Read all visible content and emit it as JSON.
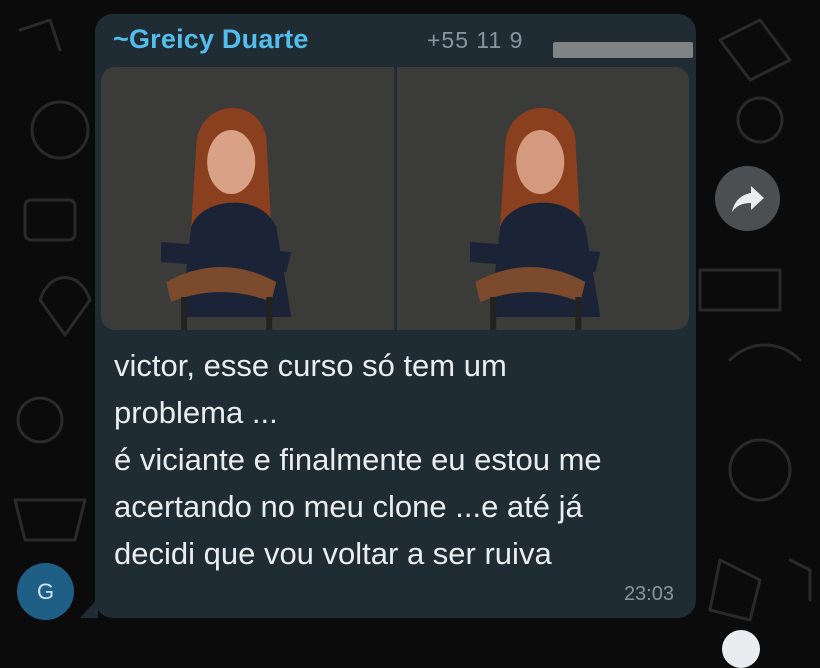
{
  "chat": {
    "sender_name": "~Greicy Duarte",
    "sender_phone": "+55 11 9",
    "avatar_initial": "G",
    "photos": [
      {
        "icon": "portrait-photo-icon"
      },
      {
        "icon": "portrait-photo-icon"
      }
    ],
    "message_lines": [
      "victor, esse curso só tem um",
      "problema ...",
      "é viciante e finalmente eu estou me",
      "acertando no meu clone ...e até já",
      "decidi que vou voltar a ser ruiva"
    ],
    "time": "23:03",
    "forward_icon": "forward-arrow-icon"
  },
  "colors": {
    "background": "#0b0b0b",
    "bubble": "#202c33",
    "sender_name": "#53bdeb",
    "text": "#e9edef",
    "meta": "#8696a0",
    "avatar": "#1f5f86"
  }
}
